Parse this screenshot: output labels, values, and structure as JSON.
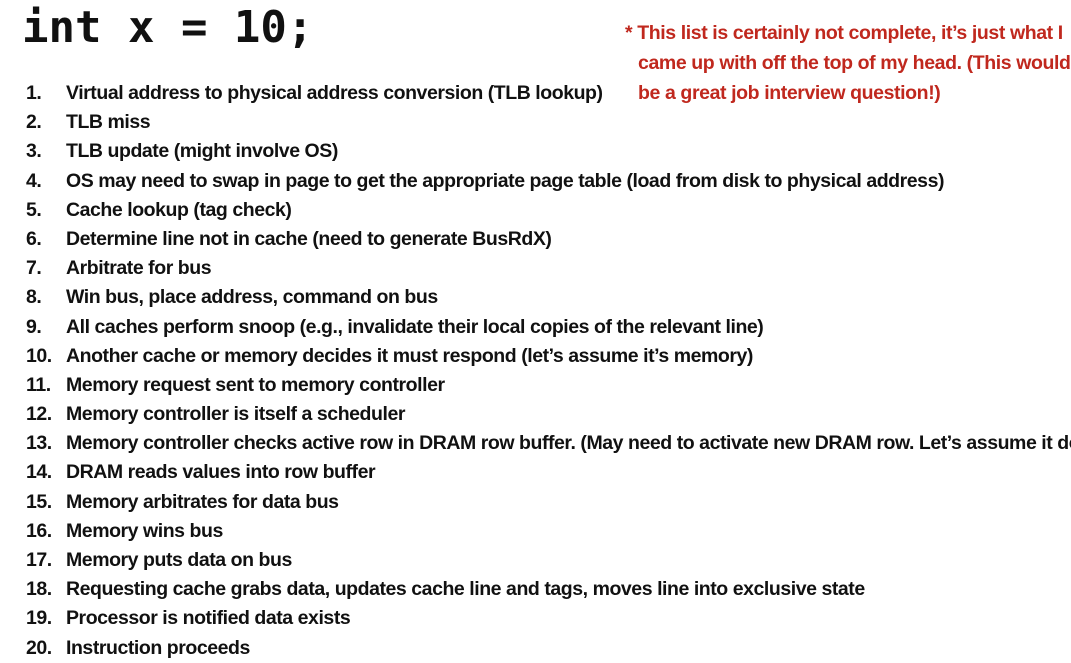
{
  "title": "int x = 10;",
  "note": {
    "lines": [
      "* This list is certainly not complete, it’s just what I",
      "came up with off the top of my head. (This would",
      "be a great job interview question!)"
    ]
  },
  "steps": [
    {
      "num": "1.",
      "text": "Virtual address to physical address conversion (TLB lookup)"
    },
    {
      "num": "2.",
      "text": "TLB miss"
    },
    {
      "num": "3.",
      "text": "TLB update (might involve OS)"
    },
    {
      "num": "4.",
      "text": "OS may need to swap in page to get the appropriate page table (load from disk to physical address)"
    },
    {
      "num": "5.",
      "text": "Cache lookup (tag check)"
    },
    {
      "num": "6.",
      "text": "Determine line not in cache (need to generate BusRdX)"
    },
    {
      "num": "7.",
      "text": "Arbitrate for bus"
    },
    {
      "num": "8.",
      "text": "Win bus, place address, command on bus"
    },
    {
      "num": "9.",
      "text": "All caches perform snoop (e.g., invalidate their local copies of the relevant line)"
    },
    {
      "num": "10.",
      "text": "Another cache or memory decides it must respond (let’s assume it’s memory)"
    },
    {
      "num": "11.",
      "text": "Memory request sent to memory controller"
    },
    {
      "num": "12.",
      "text": "Memory controller is itself a scheduler"
    },
    {
      "num": "13.",
      "text": "Memory controller checks active row in DRAM row buffer.  (May need to activate new DRAM row. Let’s assume it does.)"
    },
    {
      "num": "14.",
      "text": "DRAM reads values into row buffer"
    },
    {
      "num": "15.",
      "text": "Memory arbitrates for data bus"
    },
    {
      "num": "16.",
      "text": "Memory wins bus"
    },
    {
      "num": "17.",
      "text": "Memory puts data on bus"
    },
    {
      "num": "18.",
      "text": "Requesting cache grabs data, updates cache line and tags, moves line into exclusive state"
    },
    {
      "num": "19.",
      "text": "Processor is notified data exists"
    },
    {
      "num": "20.",
      "text": "Instruction proceeds"
    }
  ],
  "colors": {
    "text": "#111111",
    "note": "#c0281e",
    "background": "#ffffff"
  }
}
